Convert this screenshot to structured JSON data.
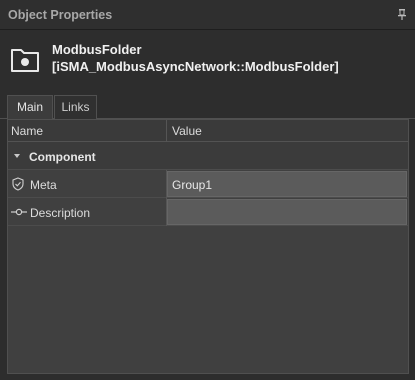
{
  "panel": {
    "title": "Object Properties",
    "pin_icon": "pin-icon"
  },
  "object": {
    "icon": "folder-icon",
    "name": "ModbusFolder",
    "type": "[iSMA_ModbusAsyncNetwork::ModbusFolder]"
  },
  "tabs": [
    {
      "label": "Main",
      "active": true
    },
    {
      "label": "Links",
      "active": false
    }
  ],
  "grid": {
    "columns": [
      "Name",
      "Value"
    ],
    "group": {
      "label": "Component",
      "expanded": true
    },
    "rows": [
      {
        "icon": "shield-icon",
        "name": "Meta",
        "value": "Group1"
      },
      {
        "icon": "connector-icon",
        "name": "Description",
        "value": ""
      }
    ]
  }
}
